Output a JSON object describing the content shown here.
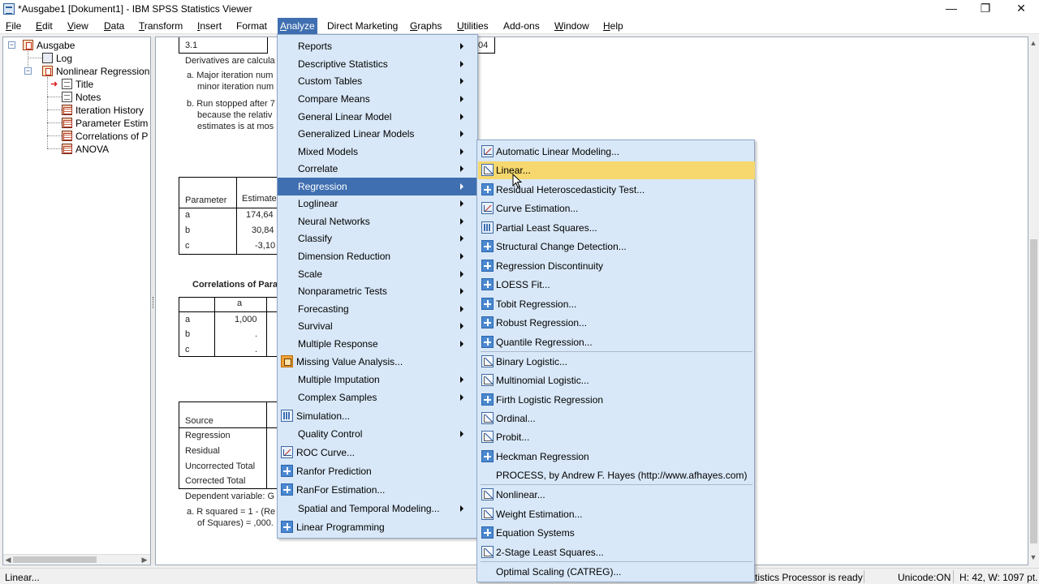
{
  "window": {
    "title": "*Ausgabe1 [Dokument1] - IBM SPSS Statistics Viewer",
    "minimize": "—",
    "restore": "❐",
    "close": "✕"
  },
  "menubar": {
    "items": [
      {
        "label": "File",
        "u": "F",
        "rest": "ile"
      },
      {
        "label": "Edit",
        "u": "E",
        "rest": "dit"
      },
      {
        "label": "View",
        "u": "V",
        "rest": "iew"
      },
      {
        "label": "Data",
        "u": "D",
        "rest": "ata"
      },
      {
        "label": "Transform",
        "u": "T",
        "rest": "ransform"
      },
      {
        "label": "Insert",
        "u": "I",
        "rest": "nsert"
      },
      {
        "label": "Format",
        "u": "",
        "rest": "Format"
      },
      {
        "label": "Analyze",
        "u": "A",
        "rest": "nalyze"
      },
      {
        "label": "Direct Marketing",
        "u": "",
        "rest": "Direct Marketing"
      },
      {
        "label": "Graphs",
        "u": "G",
        "rest": "raphs"
      },
      {
        "label": "Utilities",
        "u": "U",
        "rest": "tilities"
      },
      {
        "label": "Add-ons",
        "u": "",
        "rest": "Add-ons"
      },
      {
        "label": "Window",
        "u": "W",
        "rest": "indow"
      },
      {
        "label": "Help",
        "u": "H",
        "rest": "elp"
      }
    ]
  },
  "outline": {
    "root": "Ausgabe",
    "log": "Log",
    "nonlinear": "Nonlinear Regression",
    "children": [
      "Title",
      "Notes",
      "Iteration History",
      "Parameter Estima",
      "Correlations of Pa",
      "ANOVA"
    ]
  },
  "content": {
    "top_cell": "3.1",
    "top_cell_right": "04",
    "deriv": "Derivatives are calcula",
    "note_a1": "a. Major iteration num",
    "note_a2": "minor iteration num",
    "note_b1": "b. Run stopped after 7",
    "note_b2": "because the relativ",
    "note_b3": "estimates is at mos",
    "param_hdr": "Parameter",
    "estimate_hdr": "Estimate",
    "params": [
      {
        "name": "a",
        "val": "174,64"
      },
      {
        "name": "b",
        "val": "30,84"
      },
      {
        "name": "c",
        "val": "-3,10"
      }
    ],
    "corr_title": "Correlations of Para",
    "corr_col": "a",
    "corr_rows": [
      {
        "name": "a",
        "val": "1,000"
      },
      {
        "name": "b",
        "val": "."
      },
      {
        "name": "c",
        "val": "."
      }
    ],
    "source_hdr": "Source",
    "anova_rows": [
      "Regression",
      "Residual",
      "Uncorrected Total",
      "Corrected Total"
    ],
    "dep_var": "Dependent variable: G",
    "r2_1": "a. R squared = 1 - (Re",
    "r2_2": "of Squares) = ,000."
  },
  "analyze_menu": [
    {
      "label": "Reports",
      "sub": true
    },
    {
      "label": "Descriptive Statistics",
      "sub": true
    },
    {
      "label": "Custom Tables",
      "sub": true
    },
    {
      "label": "Compare Means",
      "sub": true
    },
    {
      "label": "General Linear Model",
      "sub": true
    },
    {
      "label": "Generalized Linear Models",
      "sub": true
    },
    {
      "label": "Mixed Models",
      "sub": true
    },
    {
      "label": "Correlate",
      "sub": true
    },
    {
      "label": "Regression",
      "sub": true,
      "highlight": true
    },
    {
      "label": "Loglinear",
      "sub": true
    },
    {
      "label": "Neural Networks",
      "sub": true
    },
    {
      "label": "Classify",
      "sub": true
    },
    {
      "label": "Dimension Reduction",
      "sub": true
    },
    {
      "label": "Scale",
      "sub": true
    },
    {
      "label": "Nonparametric Tests",
      "sub": true
    },
    {
      "label": "Forecasting",
      "sub": true
    },
    {
      "label": "Survival",
      "sub": true
    },
    {
      "label": "Multiple Response",
      "sub": true
    },
    {
      "label": "Missing Value Analysis...",
      "icon": "orange"
    },
    {
      "label": "Multiple Imputation",
      "sub": true
    },
    {
      "label": "Complex Samples",
      "sub": true
    },
    {
      "label": "Simulation...",
      "icon": "grid"
    },
    {
      "label": "Quality Control",
      "sub": true
    },
    {
      "label": "ROC Curve...",
      "icon": "chart"
    },
    {
      "label": "Ranfor Prediction",
      "icon": "plus"
    },
    {
      "label": "RanFor Estimation...",
      "icon": "plus"
    },
    {
      "label": "Spatial and Temporal Modeling...",
      "sub": true
    },
    {
      "label": "Linear Programming",
      "icon": "plus"
    }
  ],
  "regression_menu": [
    {
      "label": "Automatic Linear Modeling...",
      "icon": "chart"
    },
    {
      "label": "Linear...",
      "icon": "lin",
      "highlight": true
    },
    {
      "label": "Residual Heteroscedasticity Test...",
      "icon": "plus"
    },
    {
      "label": "Curve Estimation...",
      "icon": "chart"
    },
    {
      "label": "Partial Least Squares...",
      "icon": "grid"
    },
    {
      "label": "Structural Change Detection...",
      "icon": "plus"
    },
    {
      "label": "Regression Discontinuity",
      "icon": "plus"
    },
    {
      "label": "LOESS Fit...",
      "icon": "plus"
    },
    {
      "label": "Tobit Regression...",
      "icon": "plus"
    },
    {
      "label": "Robust Regression...",
      "icon": "plus"
    },
    {
      "label": "Quantile Regression...",
      "icon": "plus"
    },
    {
      "label": "Binary Logistic...",
      "icon": "lin",
      "sep_before": true
    },
    {
      "label": "Multinomial Logistic...",
      "icon": "lin"
    },
    {
      "label": "Firth Logistic Regression",
      "icon": "plus"
    },
    {
      "label": "Ordinal...",
      "icon": "lin"
    },
    {
      "label": "Probit...",
      "icon": "lin"
    },
    {
      "label": "Heckman Regression",
      "icon": "plus"
    },
    {
      "label": "PROCESS, by Andrew F. Hayes (http://www.afhayes.com)",
      "icon": ""
    },
    {
      "label": "Nonlinear...",
      "icon": "lin",
      "sep_before": true
    },
    {
      "label": "Weight Estimation...",
      "icon": "lin"
    },
    {
      "label": "Equation Systems",
      "icon": "plus"
    },
    {
      "label": "2-Stage Least Squares...",
      "icon": "lin"
    },
    {
      "label": "Optimal Scaling (CATREG)...",
      "icon": "",
      "sep_before": true
    }
  ],
  "statusbar": {
    "left": "Linear...",
    "processor": "tistics Processor is ready",
    "unicode": "Unicode:ON",
    "dims": "H: 42, W: 1097 pt."
  }
}
